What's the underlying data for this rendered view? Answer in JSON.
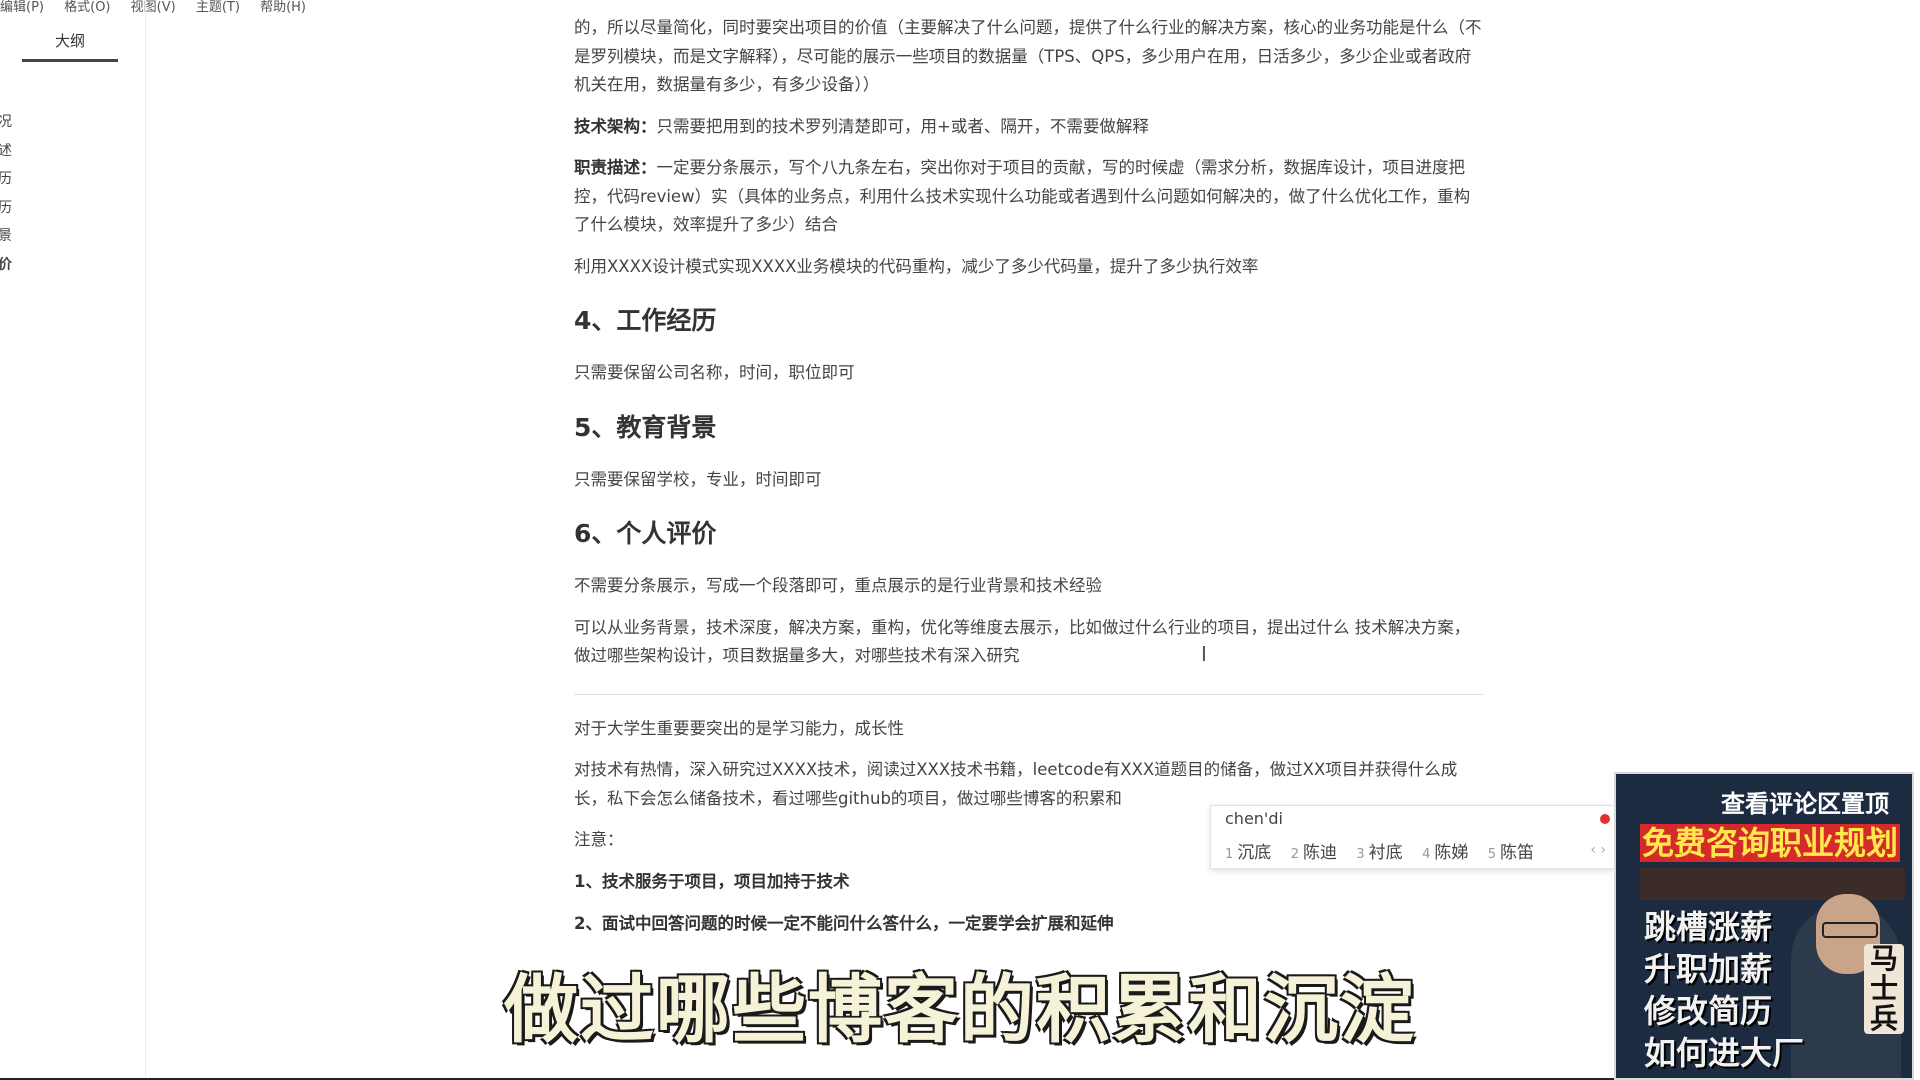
{
  "menu": [
    "编辑(P)",
    "格式(O)",
    "视图(V)",
    "主题(T)",
    "帮助(H)"
  ],
  "sidebar": {
    "tab_label": "大纲",
    "items": [
      "况",
      "述",
      "历",
      "历",
      "景",
      "价"
    ]
  },
  "document": {
    "p1": "的，所以尽量简化，同时要突出项目的价值（主要解决了什么问题，提供了什么行业的解决方案，核心的业务功能是什么（不是罗列模块，而是文字解释），尽可能的展示一些项目的数据量（TPS、QPS，多少用户在用，日活多少，多少企业或者政府机关在用，数据量有多少，有多少设备））",
    "tech_label": "技术架构：",
    "tech_text": "只需要把用到的技术罗列清楚即可，用+或者、隔开，不需要做解释",
    "duty_label": "职责描述：",
    "duty_text": "一定要分条展示，写个八九条左右，突出你对于项目的贡献，写的时候虚（需求分析，数据库设计，项目进度把控，代码review）实（具体的业务点，利用什么技术实现什么功能或者遇到什么问题如何解决的，做了什么优化工作，重构了什么模块，效率提升了多少）结合",
    "refactor_text": "利用XXXX设计模式实现XXXX业务模块的代码重构，减少了多少代码量，提升了多少执行效率",
    "h4": "4、工作经历",
    "work_text": "只需要保留公司名称，时间，职位即可",
    "h5": "5、教育背景",
    "edu_text": "只需要保留学校，专业，时间即可",
    "h6": "6、个人评价",
    "eval_text1": "不需要分条展示，写成一个段落即可，重点展示的是行业背景和技术经验",
    "eval_text2": "可以从业务背景，技术深度，解决方案，重构，优化等维度去展示，比如做过什么行业的项目，提出过什么 技术解决方案，做过哪些架构设计，项目数据量多大，对哪些技术有深入研究",
    "student_text": "对于大学生重要要突出的是学习能力，成长性",
    "student_detail": "对技术有热情，深入研究过XXXX技术，阅读过XXX技术书籍，leetcode有XXX道题目的储备，做过XX项目并获得什么成长，私下会怎么储备技术，看过哪些github的项目，做过哪些博客的积累和",
    "note_label": "注意：",
    "note1": "1、技术服务于项目，项目加持于技术",
    "note2": "2、面试中回答问题的时候一定不能问什么答什么，一定要学会扩展和延伸"
  },
  "ime": {
    "input": "chen'di",
    "candidates": [
      {
        "num": "1",
        "text": "沉底"
      },
      {
        "num": "2",
        "text": "陈迪"
      },
      {
        "num": "3",
        "text": "衬底"
      },
      {
        "num": "4",
        "text": "陈娣"
      },
      {
        "num": "5",
        "text": "陈笛"
      }
    ],
    "nav": "‹ ›"
  },
  "subtitle": "做过哪些博客的积累和沉淀",
  "promo": {
    "top_text": "查看评论区置顶",
    "title": "免费咨询职业规划",
    "lines": [
      "跳槽涨薪",
      "升职加薪",
      "修改简历",
      "如何进大厂"
    ],
    "name": "马士兵"
  }
}
